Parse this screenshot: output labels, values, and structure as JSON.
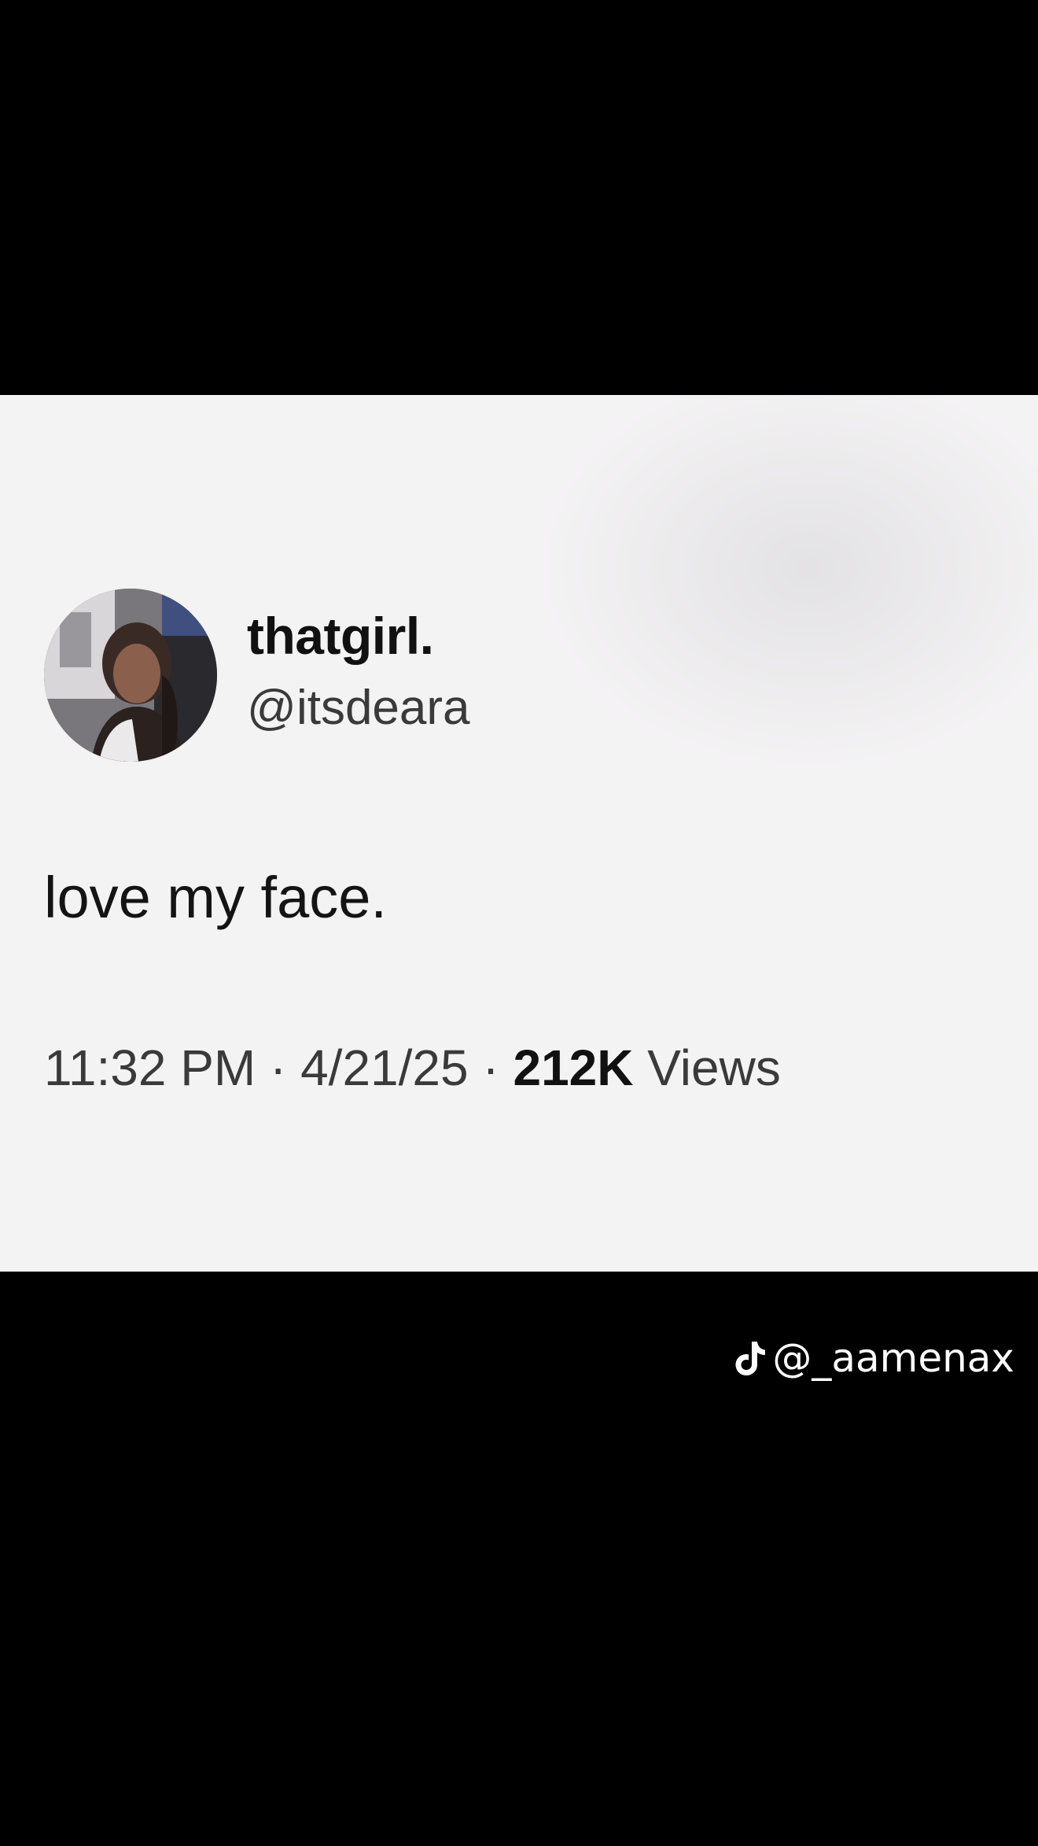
{
  "tweet": {
    "display_name": "thatgirl.",
    "handle": "@itsdeara",
    "text": "love my face.",
    "time": "11:32 PM",
    "separator": "·",
    "date": "4/21/25",
    "views_count": "212K",
    "views_label": "Views",
    "avatar_icon": "profile-photo"
  },
  "watermark": {
    "icon": "tiktok-logo-icon",
    "username": "@_aamenax"
  },
  "colors": {
    "background": "#000000",
    "card": "#f4f3f4",
    "text_primary": "#111111",
    "text_secondary": "#3a3a3a"
  }
}
